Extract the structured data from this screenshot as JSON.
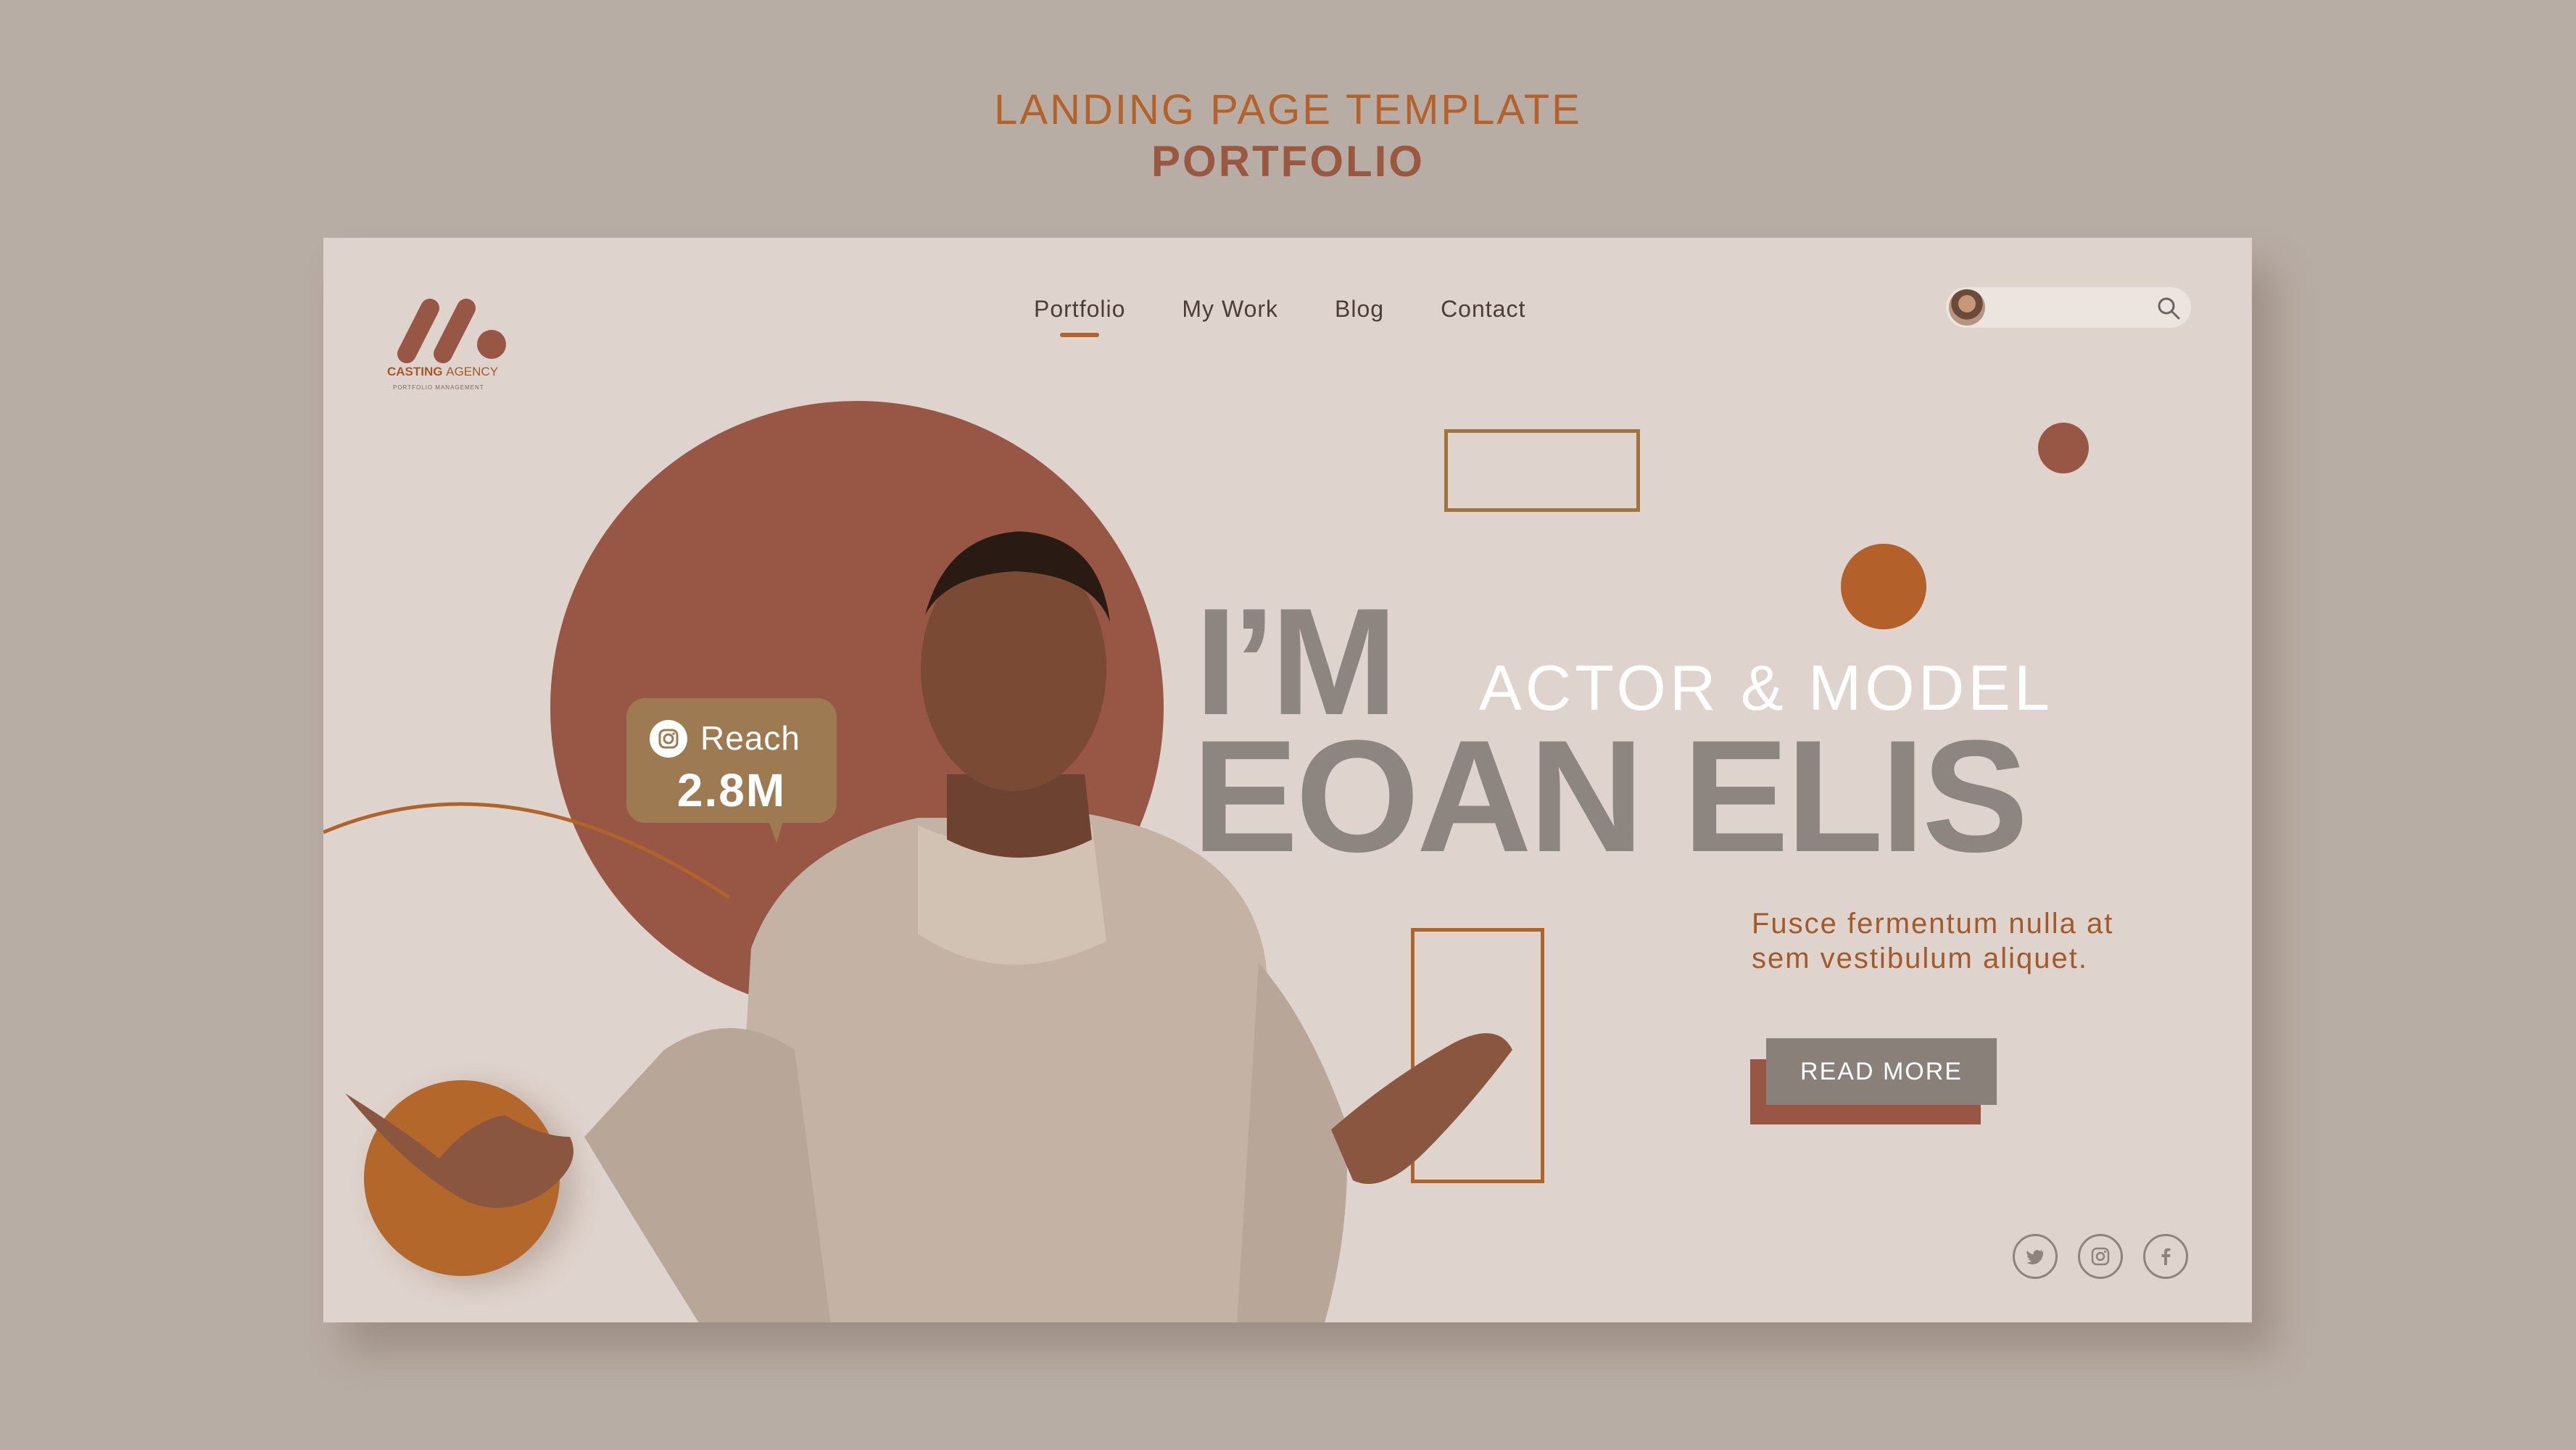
{
  "showcase": {
    "title": "LANDING PAGE TEMPLATE",
    "subtitle": "PORTFOLIO"
  },
  "logo": {
    "icon": "brand-mark-icon",
    "name_bold": "CASTING",
    "name_light": "AGENCY",
    "tagline": "PORTFOLIO MANAGEMENT"
  },
  "nav": {
    "items": [
      {
        "label": "Portfolio",
        "active": true
      },
      {
        "label": "My Work",
        "active": false
      },
      {
        "label": "Blog",
        "active": false
      },
      {
        "label": "Contact",
        "active": false
      }
    ]
  },
  "search": {
    "placeholder": "",
    "icon": "search-icon"
  },
  "hero": {
    "intro": "I’M",
    "role": "ACTOR & MODEL",
    "name": "EOAN ELIS",
    "tagline": "Fusce fermentum nulla at sem vestibulum aliquet.",
    "cta_label": "READ MORE"
  },
  "reach": {
    "icon": "instagram-icon",
    "label": "Reach",
    "value": "2.8M"
  },
  "social": [
    "twitter-icon",
    "instagram-icon",
    "facebook-icon"
  ],
  "colors": {
    "background": "#b8ada4",
    "page": "#dfd4cd",
    "accent_orange": "#b3672a",
    "accent_brown": "#985645",
    "text_gray": "#8d8580"
  }
}
